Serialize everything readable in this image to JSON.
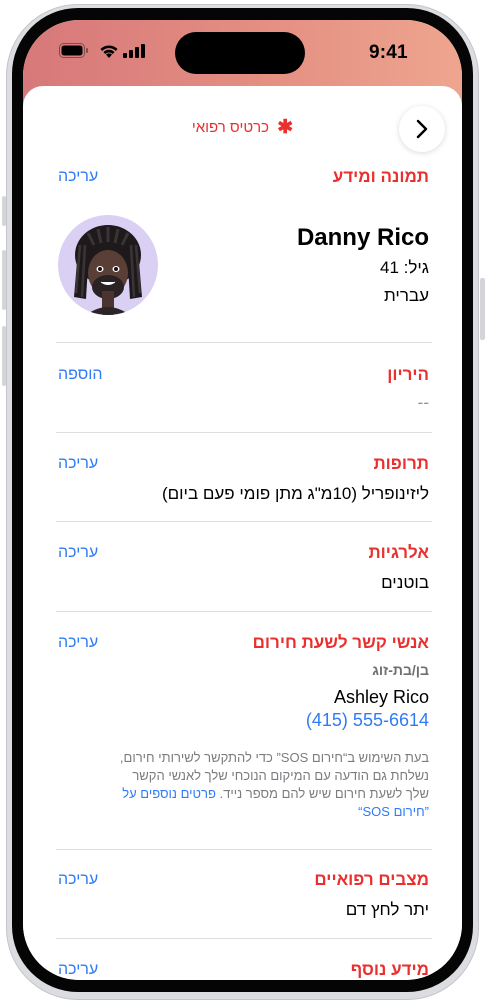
{
  "status": {
    "time": "9:41",
    "icons": [
      "signal-icon",
      "wifi-icon",
      "battery-icon"
    ]
  },
  "header": {
    "title": "כרטיס רפואי",
    "star": "✱",
    "back_icon": "chevron-right-icon"
  },
  "photo_info": {
    "title": "תמונה ומידע",
    "action": "עריכה",
    "name": "Danny Rico",
    "age": "גיל: 41",
    "language": "עברית"
  },
  "pregnancy": {
    "title": "היריון",
    "action": "הוספה",
    "value": "--"
  },
  "medications": {
    "title": "תרופות",
    "action": "עריכה",
    "value": "ליזינופריל (10מ\"ג מתן פומי פעם ביום)"
  },
  "allergies": {
    "title": "אלרגיות",
    "action": "עריכה",
    "value": "בוטנים"
  },
  "emergency_contacts": {
    "title": "אנשי קשר לשעת חירום",
    "action": "עריכה",
    "relation": "בן/בת-זוג",
    "contact_name": "Ashley Rico",
    "phone": "(415) 555-6614",
    "note_line1": "בעת השימוש ב“חירום SOS” כדי להתקשר לשירותי חירום,",
    "note_line2": "נשלחת גם הודעה עם המיקום הנוכחי שלך לאנשי הקשר",
    "note_line3": "שלך לשעת חירום שיש להם מספר נייד.",
    "note_link1": "פרטים נוספים על",
    "note_link2": "”חירום SOS“"
  },
  "conditions": {
    "title": "מצבים רפואיים",
    "action": "עריכה",
    "value": "יתר לחץ דם"
  },
  "more_info": {
    "title": "מידע נוסף",
    "action": "עריכה"
  },
  "colors": {
    "accent_red": "#e9302f",
    "link_blue": "#2f7bf5"
  }
}
